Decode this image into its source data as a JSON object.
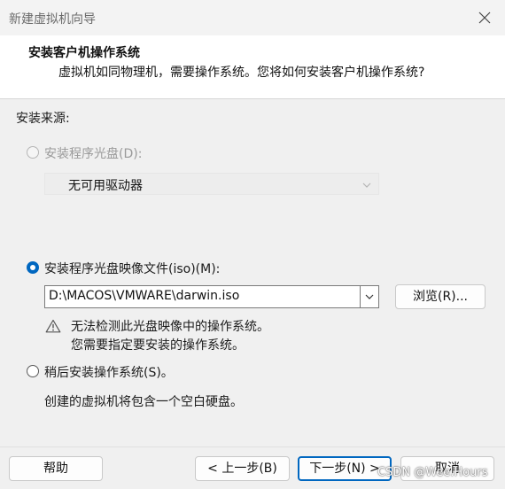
{
  "window": {
    "title": "新建虚拟机向导"
  },
  "header": {
    "title": "安装客户机操作系统",
    "subtitle": "虚拟机如同物理机，需要操作系统。您将如何安装客户机操作系统?"
  },
  "source": {
    "label": "安装来源:",
    "disc_option": {
      "label": "安装程序光盘(D):",
      "enabled": false,
      "checked": false
    },
    "disc_drive_value": "无可用驱动器",
    "iso_option": {
      "label": "安装程序光盘映像文件(iso)(M):",
      "enabled": true,
      "checked": true
    },
    "iso_path": "D:\\MACOS\\VMWARE\\darwin.iso",
    "browse_label": "浏览(R)...",
    "warning_line1": "无法检测此光盘映像中的操作系统。",
    "warning_line2": "您需要指定要安装的操作系统。",
    "later_option": {
      "label": "稍后安装操作系统(S)。",
      "checked": false
    },
    "later_desc": "创建的虚拟机将包含一个空白硬盘。"
  },
  "footer": {
    "help_label": "帮助",
    "back_label": "< 上一步(B)",
    "next_label": "下一步(N) >",
    "cancel_label": "取消"
  },
  "watermark": "CSDN @Wee.Hours",
  "colors": {
    "accent": "#0067c0",
    "background": "#f0f0f0",
    "header_bg": "#ffffff"
  },
  "icons": {
    "close": "close-icon",
    "warning": "warning-icon",
    "dropdown": "chevron-down-icon"
  }
}
